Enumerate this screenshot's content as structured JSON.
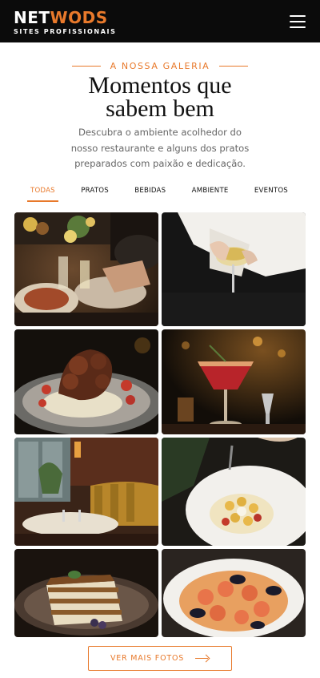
{
  "header": {
    "logo_primary": "NET",
    "logo_accent": "WODS",
    "logo_tagline": "SITES PROFISSIONAIS",
    "menu_icon": "hamburger-icon",
    "accent_color": "#e8792b",
    "bar_color": "#0b0b0b"
  },
  "gallery": {
    "eyebrow": "A NOSSA GALERIA",
    "title": "Momentos que sabem bem",
    "subtitle": "Descubra o ambiente acolhedor do nosso restaurante e alguns dos pratos preparados com paixão e dedicação.",
    "filters": [
      "TODAS",
      "PRATOS",
      "BEBIDAS",
      "AMBIENTE",
      "EVENTOS"
    ],
    "active_filter": "TODAS",
    "photos": [
      "dinner-table-friends",
      "hand-holding-wine-glass",
      "grilled-octopus-dish",
      "red-cocktail-with-rosemary",
      "restaurant-dining-room",
      "gnocchi-plate-fork",
      "tiramisu-dessert",
      "seafood-pasta-bowl"
    ],
    "more_button": "VER MAIS FOTOS",
    "more_icon": "arrow-right-icon"
  }
}
